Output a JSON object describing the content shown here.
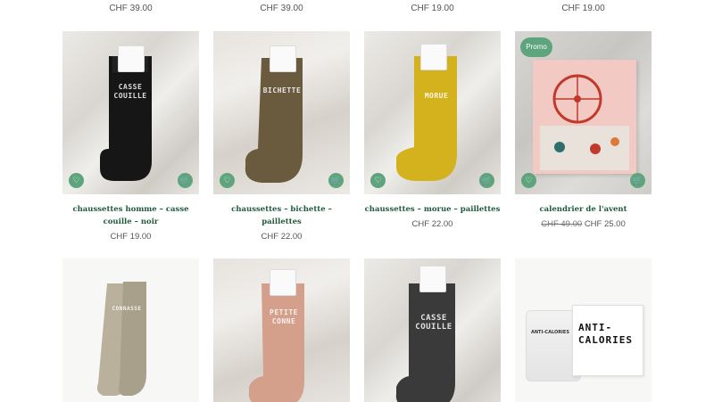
{
  "top_prices": [
    "CHF 39.00",
    "CHF 39.00",
    "CHF 19.00",
    "CHF 19.00"
  ],
  "products": [
    {
      "title": "chaussettes homme – casse couille – noir",
      "price": "CHF 19.00",
      "sock_text": "CASSE COUILLE",
      "color": "#1a1a1a"
    },
    {
      "title": "chaussettes – bichette – paillettes",
      "price": "CHF 22.00",
      "sock_text": "BICHETTE",
      "color": "#6a5a3e"
    },
    {
      "title": "chaussettes – morue – paillettes",
      "price": "CHF 22.00",
      "sock_text": "MORUE",
      "color": "#d4b21e"
    },
    {
      "title": "calendrier de l'avent",
      "old_price": "CHF 49.00",
      "price": "CHF 25.00",
      "badge": "Promo"
    }
  ],
  "row2": [
    {
      "sock_text": "CONNASSE",
      "color": "#b9b19b"
    },
    {
      "sock_text": "PETITE CONNE",
      "color": "#d4a08c"
    },
    {
      "sock_text": "CASSE COUILLE",
      "color": "#3a3a3a"
    },
    {
      "product_text": "ANTI- CALORIES",
      "jar_text": "ANTI-CALORIES"
    }
  ],
  "icons": {
    "wishlist": "heart-icon",
    "cart": "cart-icon"
  },
  "colors": {
    "accent": "#5ea47c",
    "title": "#1f5a3d"
  }
}
